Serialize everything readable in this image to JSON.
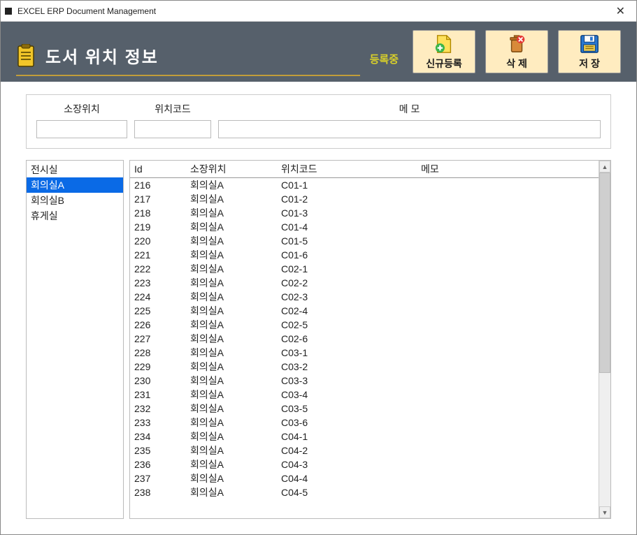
{
  "window": {
    "title": "EXCEL ERP Document Management"
  },
  "header": {
    "page_title": "도서 위치 정보",
    "status": "등록중",
    "buttons": {
      "new": "신규등록",
      "delete": "삭 제",
      "save": "저 장"
    }
  },
  "filters": {
    "location_label": "소장위치",
    "location_value": "",
    "code_label": "위치코드",
    "code_value": "",
    "memo_label": "메   모",
    "memo_value": ""
  },
  "sidebar": {
    "items": [
      {
        "label": "전시실",
        "selected": false
      },
      {
        "label": "회의실A",
        "selected": true
      },
      {
        "label": "회의실B",
        "selected": false
      },
      {
        "label": "휴게실",
        "selected": false
      }
    ]
  },
  "table": {
    "headers": {
      "id": "Id",
      "location": "소장위치",
      "code": "위치코드",
      "memo": "메모"
    },
    "rows": [
      {
        "id": "216",
        "location": "회의실A",
        "code": "C01-1",
        "memo": ""
      },
      {
        "id": "217",
        "location": "회의실A",
        "code": "C01-2",
        "memo": ""
      },
      {
        "id": "218",
        "location": "회의실A",
        "code": "C01-3",
        "memo": ""
      },
      {
        "id": "219",
        "location": "회의실A",
        "code": "C01-4",
        "memo": ""
      },
      {
        "id": "220",
        "location": "회의실A",
        "code": "C01-5",
        "memo": ""
      },
      {
        "id": "221",
        "location": "회의실A",
        "code": "C01-6",
        "memo": ""
      },
      {
        "id": "222",
        "location": "회의실A",
        "code": "C02-1",
        "memo": ""
      },
      {
        "id": "223",
        "location": "회의실A",
        "code": "C02-2",
        "memo": ""
      },
      {
        "id": "224",
        "location": "회의실A",
        "code": "C02-3",
        "memo": ""
      },
      {
        "id": "225",
        "location": "회의실A",
        "code": "C02-4",
        "memo": ""
      },
      {
        "id": "226",
        "location": "회의실A",
        "code": "C02-5",
        "memo": ""
      },
      {
        "id": "227",
        "location": "회의실A",
        "code": "C02-6",
        "memo": ""
      },
      {
        "id": "228",
        "location": "회의실A",
        "code": "C03-1",
        "memo": ""
      },
      {
        "id": "229",
        "location": "회의실A",
        "code": "C03-2",
        "memo": ""
      },
      {
        "id": "230",
        "location": "회의실A",
        "code": "C03-3",
        "memo": ""
      },
      {
        "id": "231",
        "location": "회의실A",
        "code": "C03-4",
        "memo": ""
      },
      {
        "id": "232",
        "location": "회의실A",
        "code": "C03-5",
        "memo": ""
      },
      {
        "id": "233",
        "location": "회의실A",
        "code": "C03-6",
        "memo": ""
      },
      {
        "id": "234",
        "location": "회의실A",
        "code": "C04-1",
        "memo": ""
      },
      {
        "id": "235",
        "location": "회의실A",
        "code": "C04-2",
        "memo": ""
      },
      {
        "id": "236",
        "location": "회의실A",
        "code": "C04-3",
        "memo": ""
      },
      {
        "id": "237",
        "location": "회의실A",
        "code": "C04-4",
        "memo": ""
      },
      {
        "id": "238",
        "location": "회의실A",
        "code": "C04-5",
        "memo": ""
      }
    ]
  }
}
